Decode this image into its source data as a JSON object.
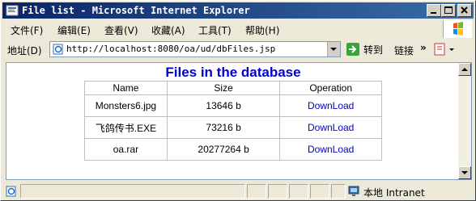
{
  "window": {
    "title": "File list - Microsoft Internet Explorer"
  },
  "menu": {
    "items": [
      "文件(F)",
      "编辑(E)",
      "查看(V)",
      "收藏(A)",
      "工具(T)",
      "帮助(H)"
    ]
  },
  "address": {
    "label": "地址(D)",
    "url": "http://localhost:8080/oa/ud/dbFiles.jsp",
    "go_label": "转到",
    "links_label": "链接",
    "links_chevron": "»"
  },
  "page": {
    "title": "Files in the database",
    "table": {
      "headers": [
        "Name",
        "Size",
        "Operation"
      ],
      "rows": [
        {
          "name": "Monsters6.jpg",
          "size": "13646 b",
          "op": "DownLoad"
        },
        {
          "name": "飞鸽传书.EXE",
          "size": "73216 b",
          "op": "DownLoad"
        },
        {
          "name": "oa.rar",
          "size": "20277264 b",
          "op": "DownLoad"
        }
      ]
    }
  },
  "status": {
    "zone_label": "本地 Intranet"
  },
  "colors": {
    "title_bar": "#0a246a",
    "link": "#0000cc",
    "heading": "#0000cc"
  }
}
